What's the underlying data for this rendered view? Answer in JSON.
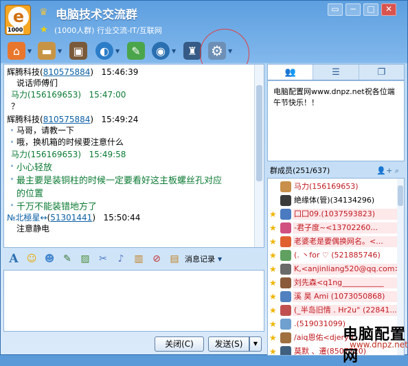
{
  "window": {
    "title": "电脑技术交流群",
    "subtitle": "(1000人群) 行业交流-IT/互联网",
    "logo_letter": "e",
    "logo_number": "1000",
    "buttons": [
      "▭",
      "−",
      "□",
      "✕"
    ]
  },
  "toolbar": {
    "icons": [
      "home-icon",
      "folder-icon",
      "screen-icon",
      "share-icon",
      "notes-icon",
      "camera-icon",
      "user-icon",
      "gear-icon"
    ],
    "glyphs": [
      "⌂",
      "▬",
      "▣",
      "◐",
      "✎",
      "◉",
      "♜",
      "⚙"
    ]
  },
  "chat": {
    "messages": [
      {
        "name": "辉腾科技",
        "id": "810575884",
        "time": "15:46:39",
        "text": "说话师傅们"
      },
      {
        "name": "马力(156169653)",
        "time": "15:47:00",
        "text": "？"
      },
      {
        "name": "辉腾科技",
        "id": "810575884",
        "time": "15:49:24",
        "text1": "马哥，请教一下",
        "text2": "哦，换机箱的时候要注意什么"
      },
      {
        "name": "马力(156169653)",
        "time": "15:49:58",
        "text1": "小心轻放",
        "text2": "最主要是装铜柱的时候一定要看好这主板螺丝孔对应",
        "text3": "的位置",
        "text4": "千万不能装错地方了"
      },
      {
        "name": "№北極星↔",
        "id": "51301441",
        "time": "15:50:44",
        "text": "注意静电"
      }
    ]
  },
  "chat_toolbar": {
    "history_label": "消息记录"
  },
  "buttons": {
    "close": "关闭(C)",
    "send": "发送(S)"
  },
  "right_panel": {
    "announcement": "电脑配置网www.dnpz.net祝各位端午节快乐！！",
    "members_header": "群成员(251/637)",
    "members": [
      {
        "name": "马力(156169653)",
        "color": "red",
        "avatar": "#c8904a"
      },
      {
        "name": "絶缘体(管)(34134296)",
        "color": "black",
        "avatar": "#3b3b3b"
      },
      {
        "name": "囗囗09.(1037593823)",
        "color": "red",
        "avatar": "#4a7ac0"
      },
      {
        "name": "-君子度~<13702260...",
        "color": "red",
        "avatar": "#d05080"
      },
      {
        "name": "老婆老是要偶换网名。<...",
        "color": "red",
        "avatar": "#e06030"
      },
      {
        "name": "(. 丶for  ♡  (521885746)",
        "color": "red",
        "avatar": "#60a060"
      },
      {
        "name": "K,<anjinliang520@qq.com>",
        "color": "red",
        "avatar": "#6a6a6a"
      },
      {
        "name": "刘先森<q1ng___________",
        "color": "red",
        "avatar": "#8a5a3a"
      },
      {
        "name": "溪 昊 Ami (1073050868)",
        "color": "red",
        "avatar": "#5080c0"
      },
      {
        "name": "(_半岛旧情 . Hr2u°  (22841...",
        "color": "red",
        "avatar": "#c05050"
      },
      {
        "name": ".(519031099)",
        "color": "red",
        "avatar": "#70a0d0"
      },
      {
        "name": "/aiq恩佑<djeryd...",
        "color": "red",
        "avatar": "#a07040"
      },
      {
        "name": "莫默 、遷(8507720)",
        "color": "red",
        "avatar": "#406080"
      }
    ]
  },
  "watermark": {
    "text": "电脑配置网",
    "url": "www.dnpz.net"
  },
  "colors": {
    "accent": "#5d9fe0",
    "member_name": "#c0181e",
    "green_text": "#0b7a33",
    "link": "#0b5fa5"
  }
}
